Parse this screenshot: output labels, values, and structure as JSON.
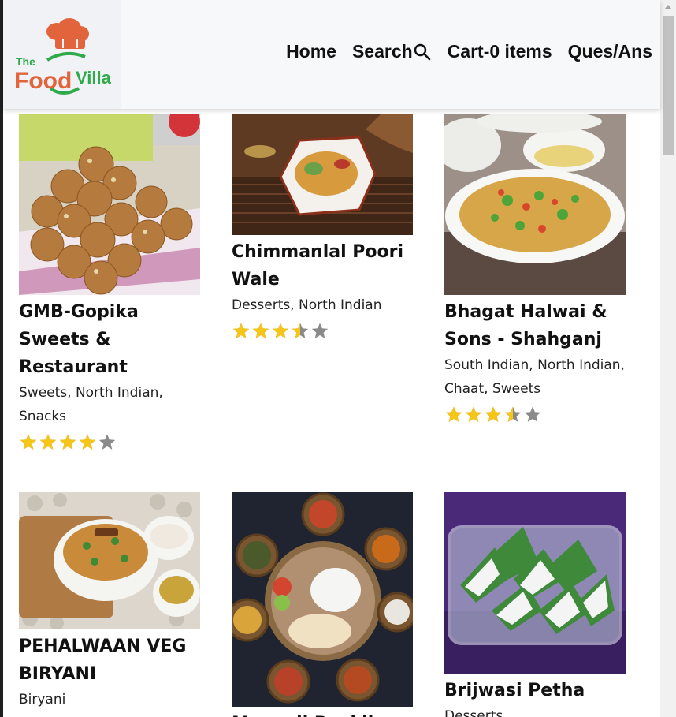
{
  "header": {
    "logo": {
      "text_small": "The",
      "text_food": "Food",
      "text_villa": "Villa"
    },
    "nav": {
      "home": "Home",
      "search": "Search",
      "cart": "Cart-0 items",
      "qa": "Ques/Ans"
    }
  },
  "colors": {
    "star_filled": "#f5c518",
    "star_empty": "#8a8a8a",
    "logo_orange": "#e2643c",
    "logo_green": "#2faa4a"
  },
  "restaurants": [
    {
      "name": "GMB-Gopika Sweets & Restaurant",
      "cuisines": "Sweets, North Indian, Snacks",
      "rating": 4.0
    },
    {
      "name": "Chimmanlal Poori Wale",
      "cuisines": "Desserts, North Indian",
      "rating": 3.5
    },
    {
      "name": "Bhagat Halwai & Sons - Shahganj",
      "cuisines": "South Indian, North Indian, Chaat, Sweets",
      "rating": 3.5
    },
    {
      "name": "PEHALWAAN VEG BIRYANI",
      "cuisines": "Biryani",
      "rating": null
    },
    {
      "name": "Mama ji Ruckli",
      "cuisines": "",
      "rating": null
    },
    {
      "name": "Brijwasi Petha",
      "cuisines": "Desserts",
      "rating": null
    }
  ]
}
